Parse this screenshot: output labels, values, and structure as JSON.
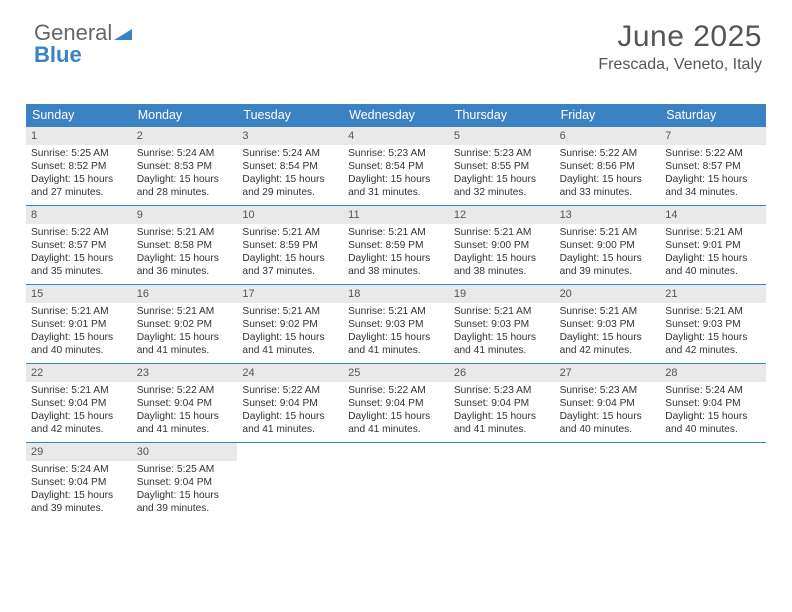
{
  "brand": {
    "part1": "General",
    "part2": "Blue"
  },
  "title": "June 2025",
  "location": "Frescada, Veneto, Italy",
  "dow": [
    "Sunday",
    "Monday",
    "Tuesday",
    "Wednesday",
    "Thursday",
    "Friday",
    "Saturday"
  ],
  "weeks": [
    [
      {
        "n": "1",
        "sr": "Sunrise: 5:25 AM",
        "ss": "Sunset: 8:52 PM",
        "d1": "Daylight: 15 hours",
        "d2": "and 27 minutes."
      },
      {
        "n": "2",
        "sr": "Sunrise: 5:24 AM",
        "ss": "Sunset: 8:53 PM",
        "d1": "Daylight: 15 hours",
        "d2": "and 28 minutes."
      },
      {
        "n": "3",
        "sr": "Sunrise: 5:24 AM",
        "ss": "Sunset: 8:54 PM",
        "d1": "Daylight: 15 hours",
        "d2": "and 29 minutes."
      },
      {
        "n": "4",
        "sr": "Sunrise: 5:23 AM",
        "ss": "Sunset: 8:54 PM",
        "d1": "Daylight: 15 hours",
        "d2": "and 31 minutes."
      },
      {
        "n": "5",
        "sr": "Sunrise: 5:23 AM",
        "ss": "Sunset: 8:55 PM",
        "d1": "Daylight: 15 hours",
        "d2": "and 32 minutes."
      },
      {
        "n": "6",
        "sr": "Sunrise: 5:22 AM",
        "ss": "Sunset: 8:56 PM",
        "d1": "Daylight: 15 hours",
        "d2": "and 33 minutes."
      },
      {
        "n": "7",
        "sr": "Sunrise: 5:22 AM",
        "ss": "Sunset: 8:57 PM",
        "d1": "Daylight: 15 hours",
        "d2": "and 34 minutes."
      }
    ],
    [
      {
        "n": "8",
        "sr": "Sunrise: 5:22 AM",
        "ss": "Sunset: 8:57 PM",
        "d1": "Daylight: 15 hours",
        "d2": "and 35 minutes."
      },
      {
        "n": "9",
        "sr": "Sunrise: 5:21 AM",
        "ss": "Sunset: 8:58 PM",
        "d1": "Daylight: 15 hours",
        "d2": "and 36 minutes."
      },
      {
        "n": "10",
        "sr": "Sunrise: 5:21 AM",
        "ss": "Sunset: 8:59 PM",
        "d1": "Daylight: 15 hours",
        "d2": "and 37 minutes."
      },
      {
        "n": "11",
        "sr": "Sunrise: 5:21 AM",
        "ss": "Sunset: 8:59 PM",
        "d1": "Daylight: 15 hours",
        "d2": "and 38 minutes."
      },
      {
        "n": "12",
        "sr": "Sunrise: 5:21 AM",
        "ss": "Sunset: 9:00 PM",
        "d1": "Daylight: 15 hours",
        "d2": "and 38 minutes."
      },
      {
        "n": "13",
        "sr": "Sunrise: 5:21 AM",
        "ss": "Sunset: 9:00 PM",
        "d1": "Daylight: 15 hours",
        "d2": "and 39 minutes."
      },
      {
        "n": "14",
        "sr": "Sunrise: 5:21 AM",
        "ss": "Sunset: 9:01 PM",
        "d1": "Daylight: 15 hours",
        "d2": "and 40 minutes."
      }
    ],
    [
      {
        "n": "15",
        "sr": "Sunrise: 5:21 AM",
        "ss": "Sunset: 9:01 PM",
        "d1": "Daylight: 15 hours",
        "d2": "and 40 minutes."
      },
      {
        "n": "16",
        "sr": "Sunrise: 5:21 AM",
        "ss": "Sunset: 9:02 PM",
        "d1": "Daylight: 15 hours",
        "d2": "and 41 minutes."
      },
      {
        "n": "17",
        "sr": "Sunrise: 5:21 AM",
        "ss": "Sunset: 9:02 PM",
        "d1": "Daylight: 15 hours",
        "d2": "and 41 minutes."
      },
      {
        "n": "18",
        "sr": "Sunrise: 5:21 AM",
        "ss": "Sunset: 9:03 PM",
        "d1": "Daylight: 15 hours",
        "d2": "and 41 minutes."
      },
      {
        "n": "19",
        "sr": "Sunrise: 5:21 AM",
        "ss": "Sunset: 9:03 PM",
        "d1": "Daylight: 15 hours",
        "d2": "and 41 minutes."
      },
      {
        "n": "20",
        "sr": "Sunrise: 5:21 AM",
        "ss": "Sunset: 9:03 PM",
        "d1": "Daylight: 15 hours",
        "d2": "and 42 minutes."
      },
      {
        "n": "21",
        "sr": "Sunrise: 5:21 AM",
        "ss": "Sunset: 9:03 PM",
        "d1": "Daylight: 15 hours",
        "d2": "and 42 minutes."
      }
    ],
    [
      {
        "n": "22",
        "sr": "Sunrise: 5:21 AM",
        "ss": "Sunset: 9:04 PM",
        "d1": "Daylight: 15 hours",
        "d2": "and 42 minutes."
      },
      {
        "n": "23",
        "sr": "Sunrise: 5:22 AM",
        "ss": "Sunset: 9:04 PM",
        "d1": "Daylight: 15 hours",
        "d2": "and 41 minutes."
      },
      {
        "n": "24",
        "sr": "Sunrise: 5:22 AM",
        "ss": "Sunset: 9:04 PM",
        "d1": "Daylight: 15 hours",
        "d2": "and 41 minutes."
      },
      {
        "n": "25",
        "sr": "Sunrise: 5:22 AM",
        "ss": "Sunset: 9:04 PM",
        "d1": "Daylight: 15 hours",
        "d2": "and 41 minutes."
      },
      {
        "n": "26",
        "sr": "Sunrise: 5:23 AM",
        "ss": "Sunset: 9:04 PM",
        "d1": "Daylight: 15 hours",
        "d2": "and 41 minutes."
      },
      {
        "n": "27",
        "sr": "Sunrise: 5:23 AM",
        "ss": "Sunset: 9:04 PM",
        "d1": "Daylight: 15 hours",
        "d2": "and 40 minutes."
      },
      {
        "n": "28",
        "sr": "Sunrise: 5:24 AM",
        "ss": "Sunset: 9:04 PM",
        "d1": "Daylight: 15 hours",
        "d2": "and 40 minutes."
      }
    ],
    [
      {
        "n": "29",
        "sr": "Sunrise: 5:24 AM",
        "ss": "Sunset: 9:04 PM",
        "d1": "Daylight: 15 hours",
        "d2": "and 39 minutes."
      },
      {
        "n": "30",
        "sr": "Sunrise: 5:25 AM",
        "ss": "Sunset: 9:04 PM",
        "d1": "Daylight: 15 hours",
        "d2": "and 39 minutes."
      },
      {
        "empty": true
      },
      {
        "empty": true
      },
      {
        "empty": true
      },
      {
        "empty": true
      },
      {
        "empty": true
      }
    ]
  ]
}
